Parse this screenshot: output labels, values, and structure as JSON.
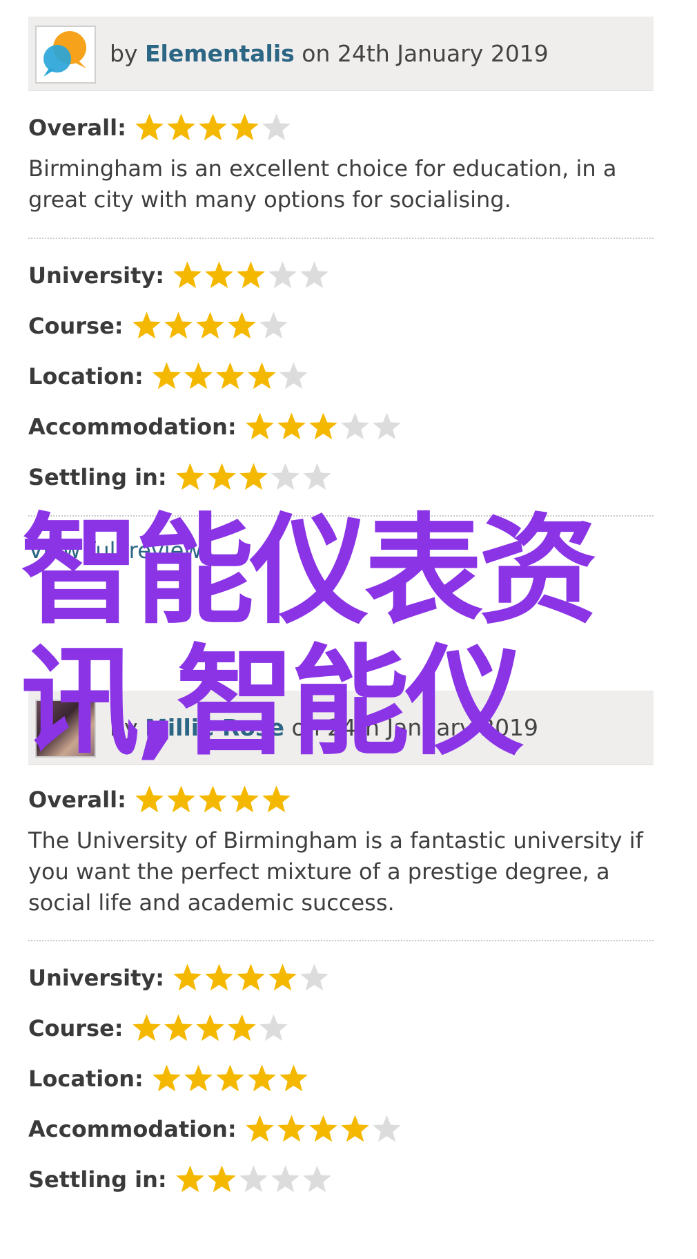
{
  "reviews": [
    {
      "by_prefix": "by",
      "author": "Elementalis",
      "date_text": "on 24th January 2019",
      "overall_label": "Overall:",
      "overall_stars": 4,
      "text": "Birmingham is an excellent choice for education, in a great city with many options for socialising.",
      "ratings": [
        {
          "label": "University:",
          "stars": 3
        },
        {
          "label": "Course:",
          "stars": 4
        },
        {
          "label": "Location:",
          "stars": 4
        },
        {
          "label": "Accommodation:",
          "stars": 3
        },
        {
          "label": "Settling in:",
          "stars": 3
        }
      ],
      "link_text": "View full review"
    },
    {
      "by_prefix": "by",
      "author": "Millie Rose",
      "date_text": "on 24th January 2019",
      "overall_label": "Overall:",
      "overall_stars": 5,
      "text": "The University of Birmingham is a fantastic university if you want the perfect mixture of a prestige degree, a social life and academic success.",
      "ratings": [
        {
          "label": "University:",
          "stars": 4
        },
        {
          "label": "Course:",
          "stars": 4
        },
        {
          "label": "Location:",
          "stars": 5
        },
        {
          "label": "Accommodation:",
          "stars": 4
        },
        {
          "label": "Settling in:",
          "stars": 2
        }
      ]
    }
  ],
  "max_stars": 5,
  "colors": {
    "star_filled": "#f5b800",
    "star_empty": "#dcdcdc",
    "link": "#2c6685",
    "watermark": "#8a34e6"
  },
  "watermark": "智能仪表资讯,智能仪"
}
